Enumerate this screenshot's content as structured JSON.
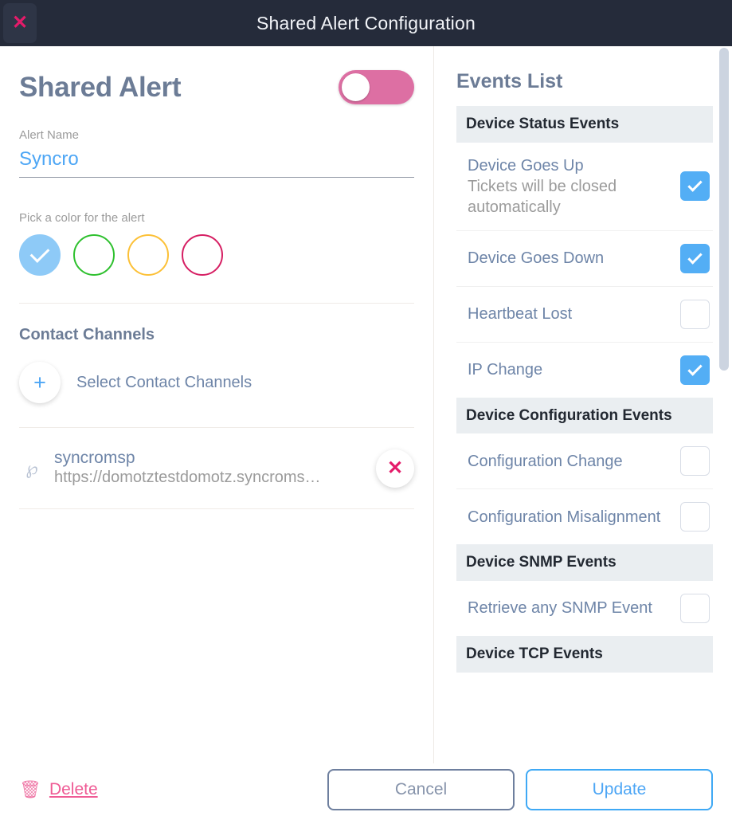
{
  "titlebar": {
    "title": "Shared Alert Configuration",
    "close_icon": "close-icon",
    "close_glyph": "✕"
  },
  "left": {
    "heading": "Shared Alert",
    "toggle": {
      "state": "off",
      "color": "#dd6fa3"
    },
    "alert_name_label": "Alert Name",
    "alert_name_value": "Syncro",
    "alert_name_placeholder": "Alert Name",
    "color_label": "Pick a color for the alert",
    "colors": [
      {
        "name": "blue",
        "hex": "#8ecaf7",
        "fill": "#8ecaf7",
        "selected": true
      },
      {
        "name": "green",
        "hex": "#2ec02e",
        "fill": "#ffffff",
        "selected": false
      },
      {
        "name": "yellow",
        "hex": "#fcc036",
        "fill": "#ffffff",
        "selected": false
      },
      {
        "name": "pink",
        "hex": "#d61f63",
        "fill": "#ffffff",
        "selected": false
      }
    ],
    "contact_channels_title": "Contact Channels",
    "add_channel_label": "Select Contact Channels",
    "add_channel_glyph": "+",
    "channel": {
      "icon": "webhook-icon",
      "icon_glyph": "℘",
      "name": "syncromsp",
      "url": "https://domotztestdomotz.syncroms…",
      "remove_glyph": "✕"
    }
  },
  "right": {
    "title": "Events List",
    "groups": [
      {
        "header": "Device Status Events",
        "events": [
          {
            "name": "Device Goes Up",
            "sub": "Tickets will be closed automatically",
            "checked": true
          },
          {
            "name": "Device Goes Down",
            "sub": "",
            "checked": true
          },
          {
            "name": "Heartbeat Lost",
            "sub": "",
            "checked": false
          },
          {
            "name": "IP Change",
            "sub": "",
            "checked": true
          }
        ]
      },
      {
        "header": "Device Configuration Events",
        "events": [
          {
            "name": "Configuration Change",
            "sub": "",
            "checked": false
          },
          {
            "name": "Configuration Misalignment",
            "sub": "",
            "checked": false
          }
        ]
      },
      {
        "header": "Device SNMP Events",
        "events": [
          {
            "name": "Retrieve any SNMP Event",
            "sub": "",
            "checked": false
          }
        ]
      },
      {
        "header": "Device TCP Events",
        "events": []
      }
    ]
  },
  "footer": {
    "delete_label": "Delete",
    "delete_icon": "trash-icon",
    "delete_glyph": "🗑",
    "cancel_label": "Cancel",
    "update_label": "Update"
  }
}
